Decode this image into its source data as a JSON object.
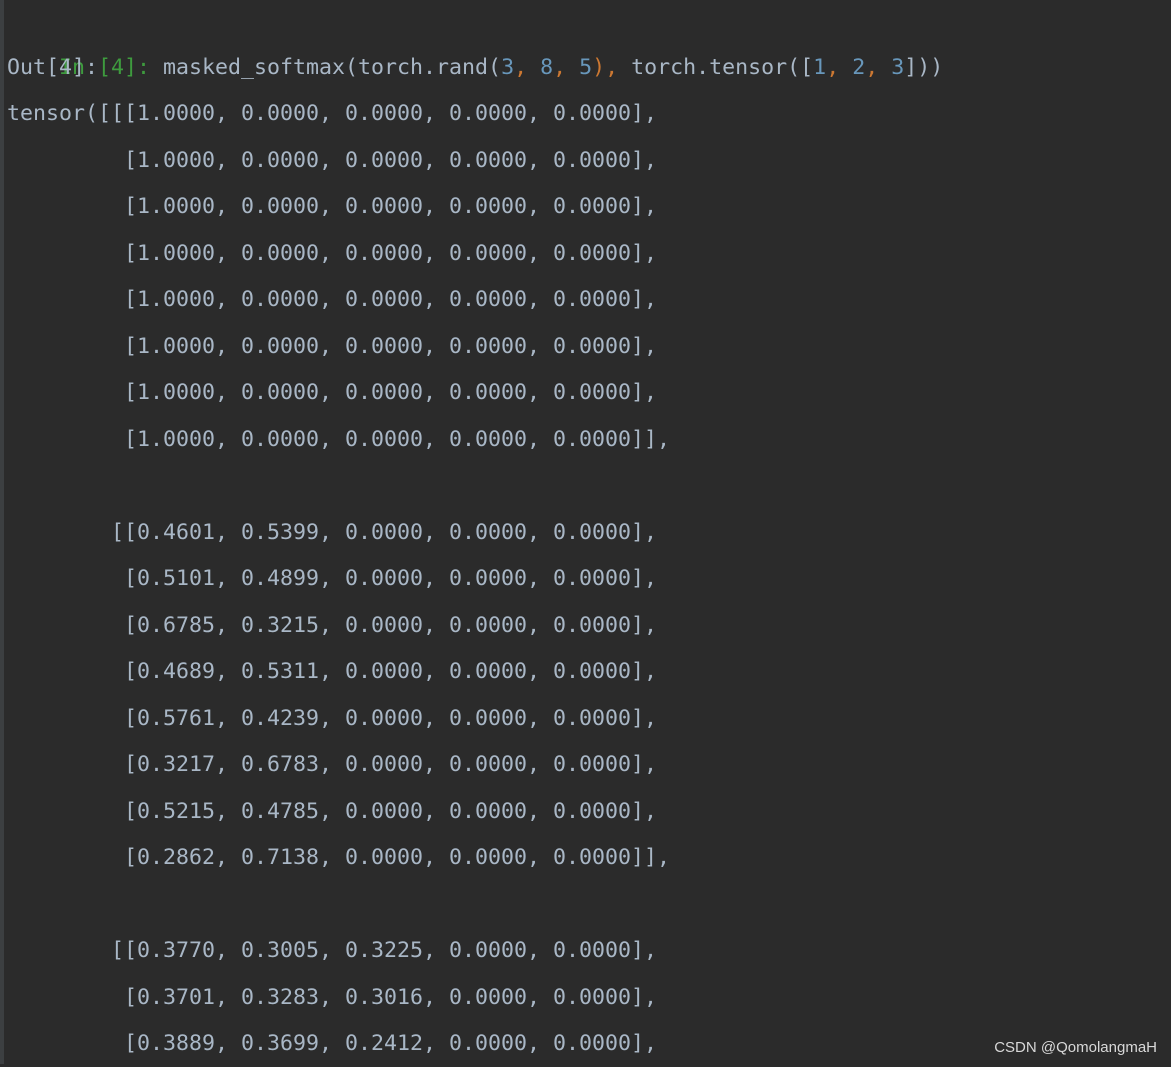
{
  "console": {
    "input_prompt": "In [4]:",
    "input_code": [
      {
        "t": "masked_softmax(torch.rand(",
        "c": "plain"
      },
      {
        "t": "3",
        "c": "num"
      },
      {
        "t": ", ",
        "c": "comma"
      },
      {
        "t": "8",
        "c": "num"
      },
      {
        "t": ", ",
        "c": "comma"
      },
      {
        "t": "5",
        "c": "num"
      },
      {
        "t": "), ",
        "c": "comma"
      },
      {
        "t": "torch.tensor([",
        "c": "plain"
      },
      {
        "t": "1",
        "c": "num"
      },
      {
        "t": ", ",
        "c": "comma"
      },
      {
        "t": "2",
        "c": "num"
      },
      {
        "t": ", ",
        "c": "comma"
      },
      {
        "t": "3",
        "c": "num"
      },
      {
        "t": "]))",
        "c": "plain"
      }
    ],
    "output_prompt": "Out[4]:",
    "output_lines": [
      "tensor([[[1.0000, 0.0000, 0.0000, 0.0000, 0.0000],",
      "         [1.0000, 0.0000, 0.0000, 0.0000, 0.0000],",
      "         [1.0000, 0.0000, 0.0000, 0.0000, 0.0000],",
      "         [1.0000, 0.0000, 0.0000, 0.0000, 0.0000],",
      "         [1.0000, 0.0000, 0.0000, 0.0000, 0.0000],",
      "         [1.0000, 0.0000, 0.0000, 0.0000, 0.0000],",
      "         [1.0000, 0.0000, 0.0000, 0.0000, 0.0000],",
      "         [1.0000, 0.0000, 0.0000, 0.0000, 0.0000]],",
      "",
      "        [[0.4601, 0.5399, 0.0000, 0.0000, 0.0000],",
      "         [0.5101, 0.4899, 0.0000, 0.0000, 0.0000],",
      "         [0.6785, 0.3215, 0.0000, 0.0000, 0.0000],",
      "         [0.4689, 0.5311, 0.0000, 0.0000, 0.0000],",
      "         [0.5761, 0.4239, 0.0000, 0.0000, 0.0000],",
      "         [0.3217, 0.6783, 0.0000, 0.0000, 0.0000],",
      "         [0.5215, 0.4785, 0.0000, 0.0000, 0.0000],",
      "         [0.2862, 0.7138, 0.0000, 0.0000, 0.0000]],",
      "",
      "        [[0.3770, 0.3005, 0.3225, 0.0000, 0.0000],",
      "         [0.3701, 0.3283, 0.3016, 0.0000, 0.0000],",
      "         [0.3889, 0.3699, 0.2412, 0.0000, 0.0000],"
    ]
  },
  "watermark": "CSDN @QomolangmaH",
  "colors": {
    "background": "#2b2b2b",
    "text": "#a9b7c6",
    "prompt": "#3e9b3e",
    "number": "#6897bb",
    "punctuation": "#cc7832"
  }
}
